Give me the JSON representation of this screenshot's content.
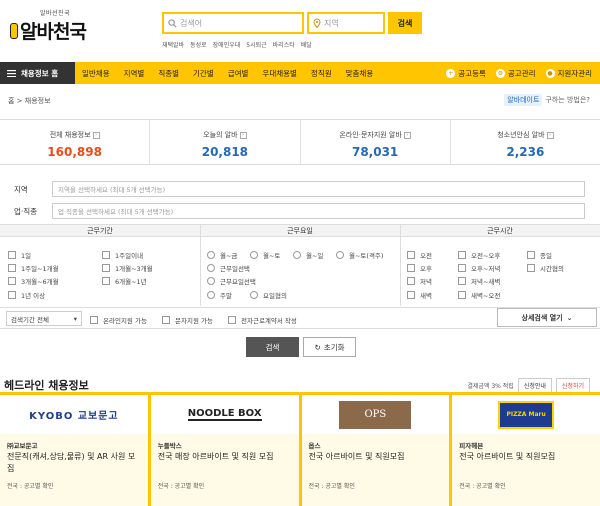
{
  "header": {
    "logo_sub": "알바선진국",
    "logo_text": "알바천국",
    "search_placeholder": "검색어",
    "location_placeholder": "지역",
    "search_button": "검색",
    "popular": [
      "재택알바",
      "동성로",
      "장애인우대",
      "5시퇴근",
      "바리스타",
      "배달"
    ]
  },
  "nav": {
    "home": "채용정보 홈",
    "items": [
      "일반채용",
      "지역별",
      "직종별",
      "기간별",
      "급여별",
      "우대채용별",
      "정직원",
      "맞춤채용"
    ],
    "right": [
      "공고등록",
      "공고관리",
      "지원자관리"
    ]
  },
  "breadcrumb": "홈 > 채용정보",
  "guide": {
    "badge": "알바데이트",
    "text": "구하는 방법은?"
  },
  "stats": [
    {
      "label": "전체 채용정보",
      "value": "160,898"
    },
    {
      "label": "오늘의 알바",
      "value": "20,818"
    },
    {
      "label": "온라인·문자지원 알바",
      "value": "78,031"
    },
    {
      "label": "청소년안심 알바",
      "value": "2,236"
    }
  ],
  "filters": {
    "region_label": "지역",
    "region_placeholder": "지역을 선택하세요 (최대 5개 선택가능)",
    "job_label": "업·직종",
    "job_placeholder": "업·직종을 선택하세요 (최대 5개 선택가능)"
  },
  "conditions": {
    "period_header": "근무기간",
    "days_header": "근무요일",
    "time_header": "근무시간",
    "period": [
      "1일",
      "1주일이내",
      "1주일~1개월",
      "1개월~3개월",
      "3개월~6개월",
      "6개월~1년",
      "1년 이상"
    ],
    "days": [
      "월~금",
      "월~토",
      "월~일",
      "월~토(격주)",
      "근무일선택",
      "근무요일선택",
      "주말",
      "요일협의"
    ],
    "time": [
      "오전",
      "오전~오후",
      "종일",
      "오후",
      "오후~저녁",
      "시간협의",
      "저녁",
      "저녁~새벽",
      "새벽",
      "새벽~오전"
    ]
  },
  "options": {
    "select": "검색기간 전체",
    "online": "온라인지원 가능",
    "sms": "문자지원 가능",
    "contract": "전자근로계약서 작성",
    "detail": "상세검색 열기"
  },
  "buttons": {
    "search": "검색",
    "reset": "초기화"
  },
  "headline": {
    "title": "헤드라인 채용정보",
    "note": "결제금액 3% 적립",
    "sort_recent": "신청안내",
    "sort_apply": "신청하기"
  },
  "cards": [
    {
      "logo": "KYOBO 교보문고",
      "company": "㈜교보문고",
      "title": "전문직(캐셔,상담,물류) 및 AR 사원 모집",
      "loc": "전국 : 공고별 확인"
    },
    {
      "logo": "NOODLE BOX",
      "company": "누들박스",
      "title": "전국 매장 아르바이트 및 직원 모집",
      "loc": "전국 : 공고별 확인"
    },
    {
      "logo": "OPS",
      "company": "옵스",
      "title": "전국 아르바이트 및 직원모집",
      "loc": "전국 : 공고별 확인"
    },
    {
      "logo": "PIZZA Maru",
      "company": "피자헤븐",
      "title": "전국 아르바이트 및 직원모집",
      "loc": "전국 : 공고별 확인"
    }
  ]
}
